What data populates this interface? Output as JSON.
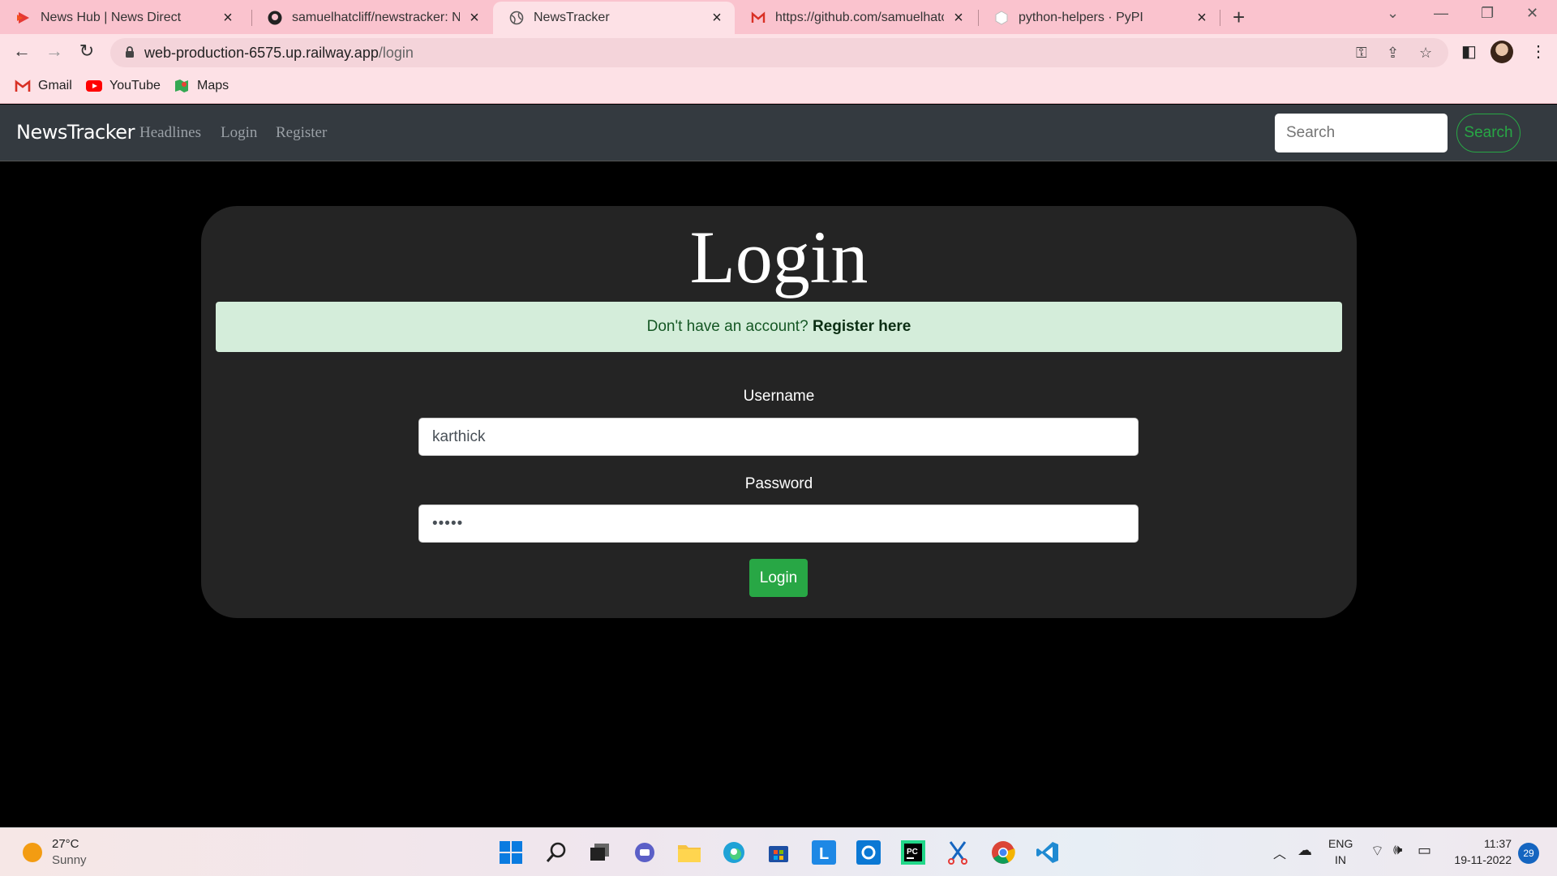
{
  "browser": {
    "tabs": [
      {
        "title": "News Hub | News Direct",
        "icon": "play-arrow-icon"
      },
      {
        "title": "samuelhatcliff/newstracker: News",
        "icon": "github-icon"
      },
      {
        "title": "NewsTracker",
        "icon": "globe-icon"
      },
      {
        "title": "https://github.com/samuelhatcliff",
        "icon": "gmail-icon"
      },
      {
        "title": "python-helpers · PyPI",
        "icon": "pypi-icon"
      }
    ],
    "url_host": "web-production-6575.up.railway.app",
    "url_path": "/login",
    "bookmarks": [
      {
        "label": "Gmail",
        "icon": "gmail-icon"
      },
      {
        "label": "YouTube",
        "icon": "youtube-icon"
      },
      {
        "label": "Maps",
        "icon": "maps-icon"
      }
    ]
  },
  "app": {
    "brand": "NewsTracker",
    "nav_links": [
      "Headlines",
      "Login",
      "Register"
    ],
    "search_placeholder": "Search",
    "search_button": "Search"
  },
  "login": {
    "title": "Login",
    "alert_text": "Don't have an account?",
    "alert_link": "Register here",
    "username_label": "Username",
    "username_value": "karthick",
    "password_label": "Password",
    "password_value": "•••••",
    "submit_label": "Login"
  },
  "taskbar": {
    "temp": "27°C",
    "condition": "Sunny",
    "lang_top": "ENG",
    "lang_bottom": "IN",
    "time": "11:37",
    "date": "19-11-2022",
    "notifications": "29"
  },
  "colors": {
    "accent_green": "#28a745",
    "alert_bg": "#d4edda",
    "navbar_bg": "#343a40",
    "card_bg": "#242424"
  }
}
